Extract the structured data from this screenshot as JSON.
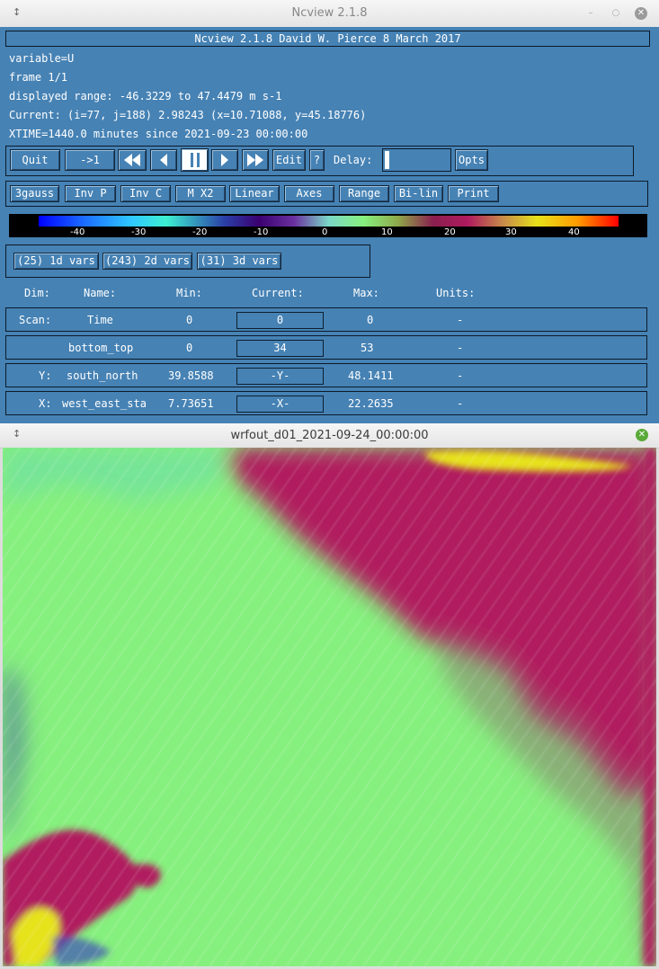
{
  "window1": {
    "title": "Ncview 2.1.8"
  },
  "header": {
    "banner": "Ncview 2.1.8 David W. Pierce  8 March 2017"
  },
  "info": {
    "variable": "variable=U",
    "frame": "frame 1/1",
    "range": "displayed range: -46.3229 to 47.4479 m s-1",
    "current": "Current: (i=77, j=188) 2.98243 (x=10.71088, y=45.18776)",
    "xtime": "XTIME=1440.0 minutes since 2021-09-23 00:00:00"
  },
  "controls": {
    "quit": "Quit",
    "to1": "->1",
    "edit": "Edit",
    "help": "?",
    "delay": "Delay:",
    "opts": "Opts"
  },
  "options": [
    "3gauss",
    "Inv P",
    "Inv C",
    "M X2",
    "Linear",
    "Axes",
    "Range",
    "Bi-lin",
    "Print"
  ],
  "colorbar": {
    "ticks": [
      "-40",
      "-30",
      "-20",
      "-10",
      "0",
      "10",
      "20",
      "30",
      "40"
    ]
  },
  "vars": {
    "d1": "(25) 1d vars",
    "d2": "(243) 2d vars",
    "d3": "(31) 3d vars"
  },
  "dims": {
    "headers": {
      "dim": "Dim:",
      "name": "Name:",
      "min": "Min:",
      "current": "Current:",
      "max": "Max:",
      "units": "Units:"
    },
    "rows": [
      {
        "dim": "Scan:",
        "name": "Time",
        "min": "0",
        "current": "0",
        "max": "0",
        "units": "-"
      },
      {
        "dim": "",
        "name": "bottom_top",
        "min": "0",
        "current": "34",
        "max": "53",
        "units": "-"
      },
      {
        "dim": "Y:",
        "name": "south_north",
        "min": "39.8588",
        "current": "-Y-",
        "max": "48.1411",
        "units": "-"
      },
      {
        "dim": "X:",
        "name": "west_east_sta",
        "min": "7.73651",
        "current": "-X-",
        "max": "22.2635",
        "units": "-"
      }
    ]
  },
  "window2": {
    "title": "wrfout_d01_2021-09-24_00:00:00"
  },
  "colors": {
    "panel": "#4682b4",
    "green": "#86f07e",
    "magenta": "#b01a5e",
    "yellow": "#e6e21a"
  }
}
